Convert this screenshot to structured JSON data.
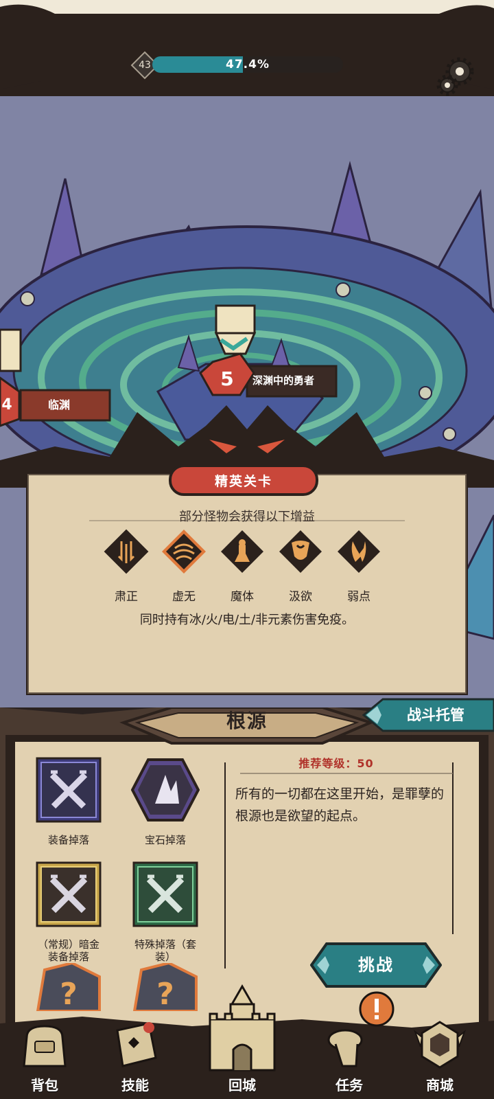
{
  "hud": {
    "level": "43",
    "xp_text": "47.4%",
    "xp_fraction": 0.474
  },
  "map": {
    "left_node_number": "4",
    "left_node_label": "临渊",
    "current_node_number": "5",
    "current_node_label": "深渊中的勇者"
  },
  "elite": {
    "title": "精英关卡",
    "subtitle": "部分怪物会获得以下增益",
    "buffs": [
      {
        "label": "肃正",
        "icon": "twin-arrows-down-icon",
        "selected": false
      },
      {
        "label": "虚无",
        "icon": "void-wave-icon",
        "selected": true
      },
      {
        "label": "魔体",
        "icon": "demon-figure-icon",
        "selected": false
      },
      {
        "label": "汲欲",
        "icon": "shield-drain-icon",
        "selected": false
      },
      {
        "label": "弱点",
        "icon": "cracked-shard-icon",
        "selected": false
      }
    ],
    "immune_text": "同时持有冰/火/电/土/非元素伤害免疫。"
  },
  "source": {
    "title": "根源",
    "auto_battle_label": "战斗托管",
    "recommended_level": "推荐等级：50",
    "description": "所有的一切都在这里开始，是罪孽的根源也是欲望的起点。",
    "challenge_label": "挑战",
    "drops": [
      {
        "label": "装备掉落",
        "icon": "crossed-swords-icon"
      },
      {
        "label": "宝石掉落",
        "icon": "gem-icon"
      },
      {
        "label": "（常规）暗金\n装备掉落",
        "icon": "crossed-swords-gold-icon"
      },
      {
        "label": "特殊掉落（套\n装）",
        "icon": "crossed-swords-green-icon"
      }
    ]
  },
  "nav": [
    {
      "label": "背包",
      "icon": "backpack-icon"
    },
    {
      "label": "技能",
      "icon": "skill-book-icon"
    },
    {
      "label": "回城",
      "icon": "castle-icon"
    },
    {
      "label": "任务",
      "icon": "scroll-icon"
    },
    {
      "label": "商城",
      "icon": "shop-icon"
    }
  ],
  "colors": {
    "xp_fill": "#2a8b96",
    "teal_button": "#2a7f84",
    "elite_red": "#c9473a",
    "parchment": "#e9dcc1",
    "frame_dark": "#2b211c",
    "warning_red": "#b0322a"
  }
}
